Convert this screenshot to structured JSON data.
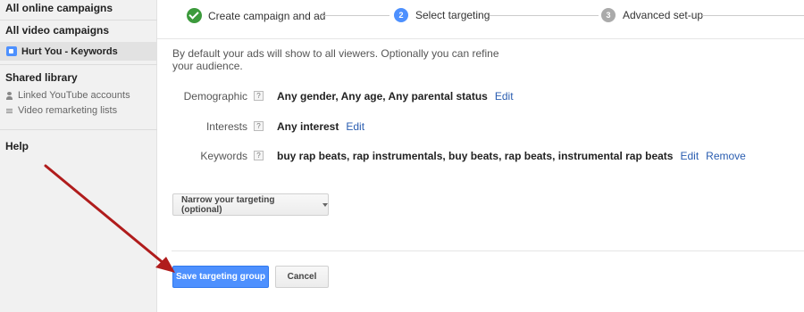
{
  "sidebar": {
    "all_online": "All online campaigns",
    "all_video": "All video campaigns",
    "campaign": "Hurt You - Keywords",
    "shared_library": "Shared library",
    "linked_youtube": "Linked YouTube accounts",
    "remarketing": "Video remarketing lists",
    "help": "Help"
  },
  "stepper": {
    "step1": "Create campaign and ad",
    "step2_num": "2",
    "step2": "Select targeting",
    "step3_num": "3",
    "step3": "Advanced set-up"
  },
  "intro": "By default your ads will show to all viewers. Optionally you can refine your audience.",
  "targeting": {
    "demographic": {
      "label": "Demographic",
      "help": "?",
      "value": "Any gender, Any age, Any parental status",
      "edit": "Edit"
    },
    "interests": {
      "label": "Interests",
      "help": "?",
      "value": "Any interest",
      "edit": "Edit"
    },
    "keywords": {
      "label": "Keywords",
      "help": "?",
      "value": "buy rap beats, rap instrumentals, buy beats, rap beats, instrumental rap beats",
      "edit": "Edit",
      "remove": "Remove"
    }
  },
  "narrow_button": "Narrow your targeting (optional)",
  "save_button": "Save targeting group",
  "cancel_button": "Cancel",
  "colors": {
    "primary": "#4d90fe",
    "success": "#3c9a3c",
    "link": "#2a5db0",
    "annotation_arrow": "#b01c1c"
  },
  "icons": [
    "video-campaign-icon",
    "person-icon",
    "list-icon",
    "check-icon",
    "caret-down-icon",
    "help-icon"
  ]
}
